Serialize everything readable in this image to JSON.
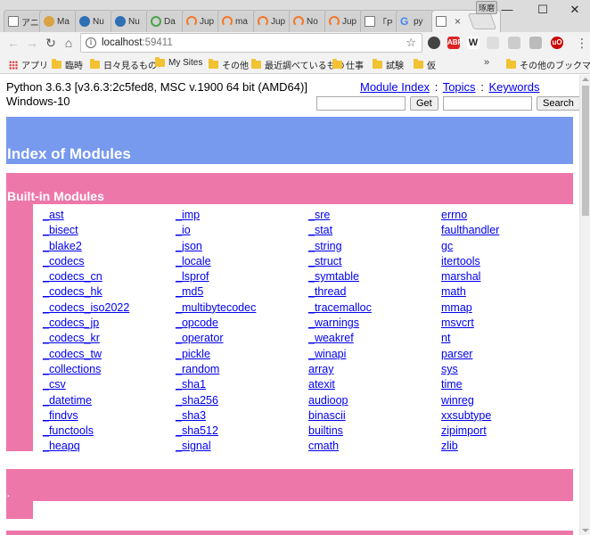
{
  "browser": {
    "tabs": [
      {
        "favicon": "page-icon",
        "title": "アニ"
      },
      {
        "favicon": "ma-icon",
        "title": "Ma"
      },
      {
        "favicon": "nu-icon",
        "title": "Nu"
      },
      {
        "favicon": "nu-icon",
        "title": "Nu"
      },
      {
        "favicon": "da-icon",
        "title": "Da"
      },
      {
        "favicon": "jupyter-icon",
        "title": "Jup"
      },
      {
        "favicon": "jupyter-icon",
        "title": "ma"
      },
      {
        "favicon": "jupyter-icon",
        "title": "Jup"
      },
      {
        "favicon": "jupyter-icon",
        "title": "No"
      },
      {
        "favicon": "jupyter-icon",
        "title": "Jup"
      },
      {
        "favicon": "page-icon",
        "title": "「P"
      },
      {
        "favicon": "google-icon",
        "title": "py"
      },
      {
        "favicon": "page-icon",
        "title": "",
        "active": true,
        "close": "×"
      }
    ],
    "profile_label": "琢磨",
    "window_controls": {
      "minimize": "—",
      "maximize": "☐",
      "close": "✕"
    },
    "url_host": "localhost",
    "url_port": ":59411",
    "bookmarks": [
      "アプリ",
      "臨時",
      "日々見るもの",
      "My Sites",
      "その他",
      "最近調べているもの",
      "仕事",
      "試験",
      "仮"
    ],
    "bookmarks_more": "»",
    "other_bookmarks": "その他のブックマーク"
  },
  "page": {
    "python_version": "Python 3.6.3 [v3.6.3:2c5fed8, MSC v.1900 64 bit (AMD64)]",
    "platform": "Windows-10",
    "links": {
      "module_index": "Module Index",
      "topics": "Topics",
      "keywords": "Keywords",
      "separator": ":"
    },
    "get_button": "Get",
    "search_button": "Search",
    "heading": "Index of Modules",
    "section_builtin": "Built-in Modules",
    "section2_marker": ".",
    "columns": [
      [
        "_ast",
        "_bisect",
        "_blake2",
        "_codecs",
        "_codecs_cn",
        "_codecs_hk",
        "_codecs_iso2022",
        "_codecs_jp",
        "_codecs_kr",
        "_codecs_tw",
        "_collections",
        "_csv",
        "_datetime",
        "_findvs",
        "_functools",
        "_heapq"
      ],
      [
        "_imp",
        "_io",
        "_json",
        "_locale",
        "_lsprof",
        "_md5",
        "_multibytecodec",
        "_opcode",
        "_operator",
        "_pickle",
        "_random",
        "_sha1",
        "_sha256",
        "_sha3",
        "_sha512",
        "_signal"
      ],
      [
        "_sre",
        "_stat",
        "_string",
        "_struct",
        "_symtable",
        "_thread",
        "_tracemalloc",
        "_warnings",
        "_weakref",
        "_winapi",
        "array",
        "atexit",
        "audioop",
        "binascii",
        "builtins",
        "cmath"
      ],
      [
        "errno",
        "faulthandler",
        "gc",
        "itertools",
        "marshal",
        "math",
        "mmap",
        "msvcrt",
        "nt",
        "parser",
        "sys",
        "time",
        "winreg",
        "xxsubtype",
        "zipimport",
        "zlib"
      ]
    ]
  }
}
